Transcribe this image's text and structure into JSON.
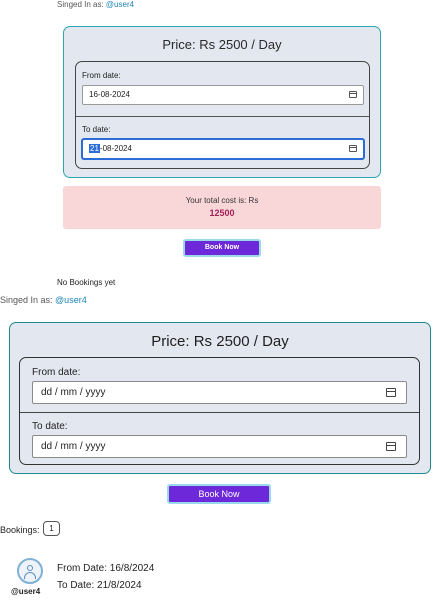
{
  "top": {
    "signed_in_label": "Singed In as: ",
    "user": "@user4",
    "price": "Price: Rs 2500 / Day",
    "from_label": "From date:",
    "from_value": "16-08-2024",
    "to_label": "To date:",
    "to_value_selected": "21",
    "to_value_rest": "-08-2024",
    "cost_label": "Your total cost is: Rs",
    "cost_value": "12500",
    "book_button": "Book Now",
    "no_bookings": "No Bookings yet"
  },
  "bottom": {
    "signed_in_label": "Singed In as: ",
    "user": "@user4",
    "price": "Price: Rs 2500 / Day",
    "from_label": "From date:",
    "from_placeholder": "dd / mm / yyyy",
    "to_label": "To date:",
    "to_placeholder": "dd / mm / yyyy",
    "book_button": "Book Now",
    "bookings_label": "Bookings:",
    "bookings_count": "1",
    "booking": {
      "user": "@user4",
      "from": "From Date: 16/8/2024",
      "to": "To Date: 21/8/2024"
    }
  },
  "icons": [
    "calendar-icon",
    "avatar-icon"
  ],
  "colors": {
    "accent_button": "#6d28d9",
    "card_border": "#2aa7b0",
    "cost_background": "#f9d7d8",
    "cost_value": "#a3205a",
    "username": "#1d84b5"
  }
}
